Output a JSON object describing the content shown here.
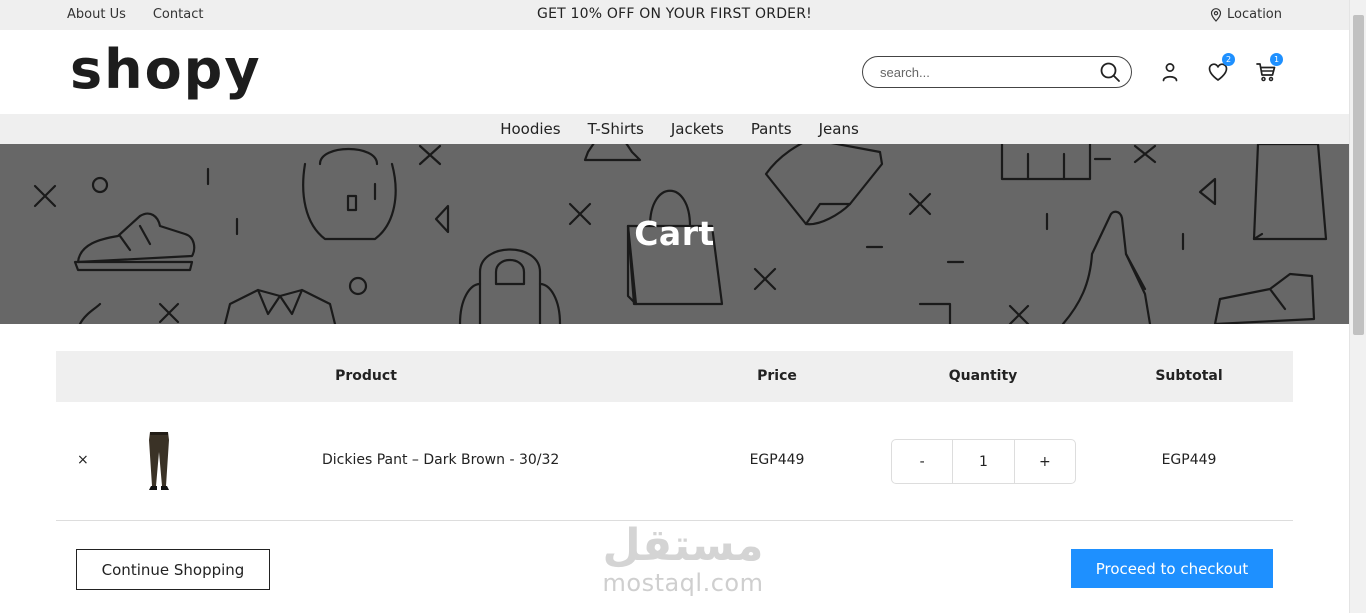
{
  "topbar": {
    "links": [
      "About Us",
      "Contact"
    ],
    "promo": "GET 10% OFF ON YOUR FIRST ORDER!",
    "location_label": "Location"
  },
  "header": {
    "logo": "shopy",
    "search_placeholder": "search...",
    "wishlist_count": "2",
    "cart_count": "1"
  },
  "nav": {
    "items": [
      "Hoodies",
      "T-Shirts",
      "Jackets",
      "Pants",
      "Jeans"
    ]
  },
  "banner": {
    "title": "Cart"
  },
  "cart": {
    "headers": {
      "product": "Product",
      "price": "Price",
      "quantity": "Quantity",
      "subtotal": "Subtotal"
    },
    "items": [
      {
        "remove": "×",
        "name": "Dickies Pant – Dark Brown - 30/32",
        "price": "EGP449",
        "qty_minus": "-",
        "quantity": "1",
        "qty_plus": "+",
        "subtotal": "EGP449"
      }
    ]
  },
  "actions": {
    "continue": "Continue Shopping",
    "checkout": "Proceed to checkout"
  },
  "watermark": {
    "arabic": "مستقل",
    "latin": "mostaql.com"
  },
  "colors": {
    "accent": "#1e90ff",
    "banner": "#676767",
    "bar": "#efefef"
  }
}
